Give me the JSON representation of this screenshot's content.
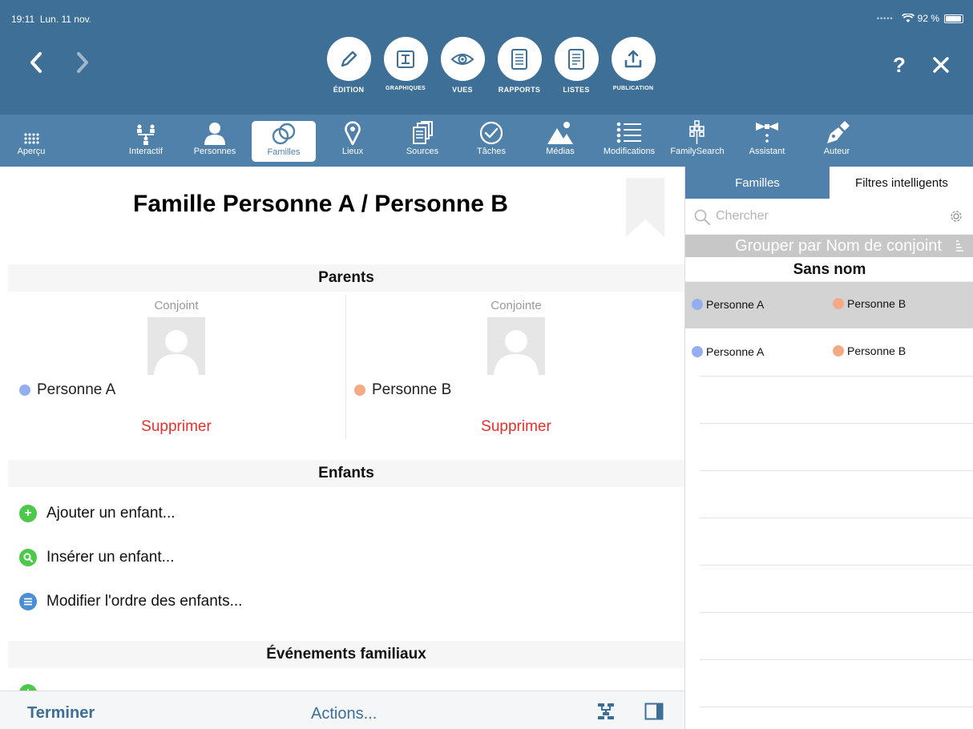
{
  "status": {
    "time": "19:11",
    "date": "Lun. 11 nov.",
    "battery": "92 %"
  },
  "header": {
    "back_icon": "chevron-left-icon",
    "forward_icon": "chevron-right-icon",
    "help_label": "?",
    "close_label": "✕",
    "modes": [
      {
        "label": "ÉDITION",
        "icon": "pencil-icon"
      },
      {
        "label": "GRAPHIQUES",
        "icon": "chart-icon"
      },
      {
        "label": "VUES",
        "icon": "eye-icon"
      },
      {
        "label": "RAPPORTS",
        "icon": "document-icon"
      },
      {
        "label": "LISTES",
        "icon": "list-document-icon"
      },
      {
        "label": "PUBLICATION",
        "icon": "upload-icon"
      }
    ]
  },
  "toolbar": {
    "items": [
      {
        "label": "Aperçu",
        "icon": "grid-icon"
      },
      {
        "label": "Interactif",
        "icon": "tree-icon"
      },
      {
        "label": "Personnes",
        "icon": "person-icon"
      },
      {
        "label": "Familles",
        "icon": "rings-icon"
      },
      {
        "label": "Lieux",
        "icon": "pin-icon"
      },
      {
        "label": "Sources",
        "icon": "sources-icon"
      },
      {
        "label": "Tâches",
        "icon": "check-icon"
      },
      {
        "label": "Médias",
        "icon": "media-icon"
      },
      {
        "label": "Modifications",
        "icon": "list-icon"
      },
      {
        "label": "FamilySearch",
        "icon": "familysearch-icon"
      },
      {
        "label": "Assistant",
        "icon": "assistant-icon"
      },
      {
        "label": "Auteur",
        "icon": "pen-icon"
      }
    ]
  },
  "main": {
    "title": "Famille Personne A / Personne B",
    "parents_header": "Parents",
    "parents": [
      {
        "role": "Conjoint",
        "name": "Personne A",
        "delete_label": "Supprimer",
        "color": "#94aef0"
      },
      {
        "role": "Conjointe",
        "name": "Personne B",
        "delete_label": "Supprimer",
        "color": "#f5aa86"
      }
    ],
    "children_header": "Enfants",
    "child_actions": [
      {
        "label": "Ajouter un enfant...",
        "icon": "plus-circle-icon"
      },
      {
        "label": "Insérer un enfant...",
        "icon": "search-circle-icon"
      },
      {
        "label": "Modifier l'ordre des enfants...",
        "icon": "reorder-circle-icon"
      }
    ],
    "events_header": "Événements familiaux"
  },
  "bottom": {
    "finish_label": "Terminer",
    "actions_label": "Actions..."
  },
  "sidebar": {
    "tabs": [
      "Familles",
      "Filtres intelligents"
    ],
    "search_placeholder": "Chercher",
    "group_by_label": "Grouper par Nom de conjoint",
    "group_title": "Sans nom",
    "families": [
      {
        "person1": "Personne A",
        "person2": "Personne B",
        "selected": true
      },
      {
        "person1": "Personne A",
        "person2": "Personne B",
        "selected": false
      }
    ]
  }
}
